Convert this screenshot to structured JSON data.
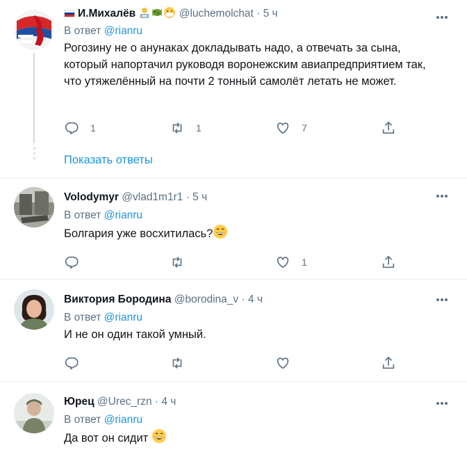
{
  "tweets": [
    {
      "name": "И.Михалёв",
      "handle": "@luchemolchat",
      "time": "· 5 ч",
      "reply_prefix": "В ответ",
      "reply_to": "@rianru",
      "text": "Рогозину не о анунаках докладывать надо, а отвечать за сына, который напортачил руководя воронежским авиапредприятием так, что утяжелённый на почти 2 тонный самолёт летать не может.",
      "replies": "1",
      "retweets": "1",
      "likes": "7"
    },
    {
      "name": "Volodymyr",
      "handle": "@vlad1m1r1",
      "time": "· 5 ч",
      "reply_prefix": "В ответ",
      "reply_to": "@rianru",
      "text": "Болгария уже восхитилась?",
      "replies": "",
      "retweets": "",
      "likes": "1"
    },
    {
      "name": "Виктория Бородина",
      "handle": "@borodina_v",
      "time": "· 4 ч",
      "reply_prefix": "В ответ",
      "reply_to": "@rianru",
      "text": "И не он один такой умный.",
      "replies": "",
      "retweets": "",
      "likes": ""
    },
    {
      "name": "Юрец",
      "handle": "@Urec_rzn",
      "time": "· 4 ч",
      "reply_prefix": "В ответ",
      "reply_to": "@rianru",
      "text": "Да вот он сидит",
      "replies": "",
      "retweets": "",
      "likes": ""
    }
  ],
  "show_replies_label": "Показать ответы",
  "colors": {
    "accent": "#1b95e0",
    "muted": "#5b7083",
    "text": "#0f1419",
    "divider": "#ebeef0"
  }
}
